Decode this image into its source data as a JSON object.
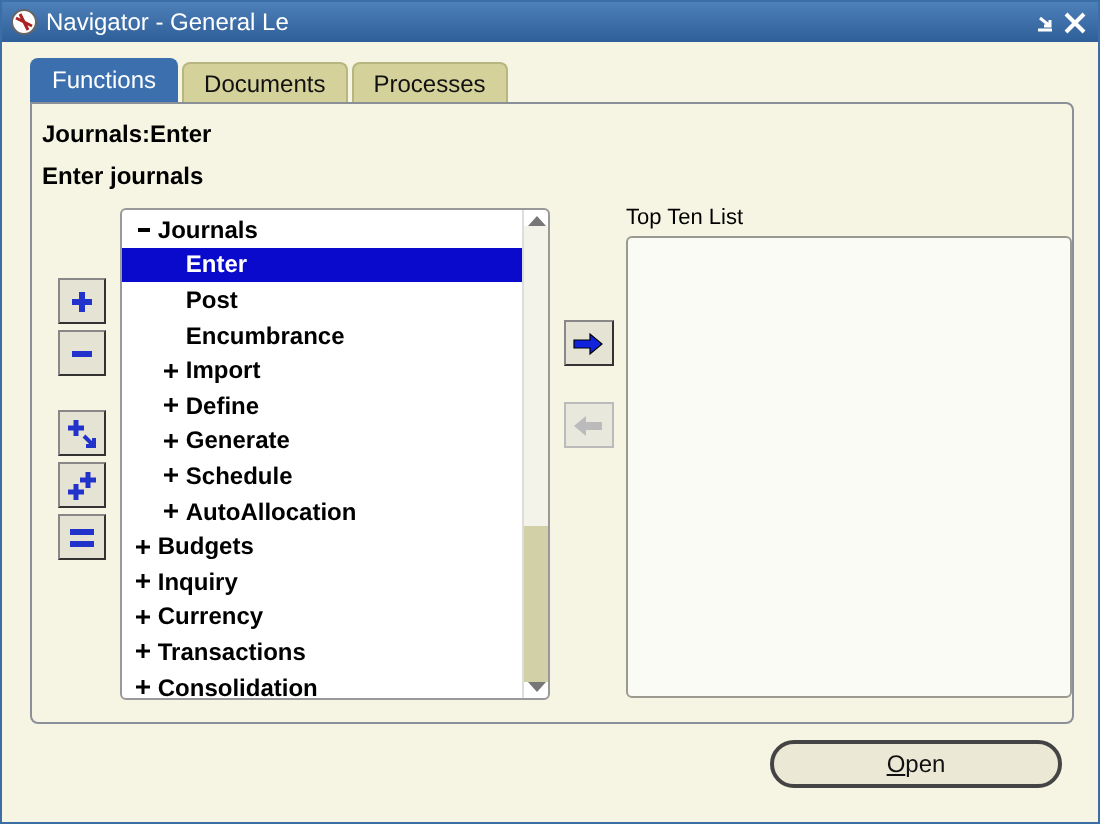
{
  "window": {
    "title": "Navigator - General Le"
  },
  "tabs": [
    {
      "label": "Functions",
      "selected": true
    },
    {
      "label": "Documents",
      "selected": false
    },
    {
      "label": "Processes",
      "selected": false
    }
  ],
  "function_path": "Journals:Enter",
  "function_description": "Enter journals",
  "tree": [
    {
      "label": "Journals",
      "kind": "node",
      "expanded": true,
      "selected": false,
      "children": [
        {
          "label": "Enter",
          "kind": "leaf",
          "selected": true
        },
        {
          "label": "Post",
          "kind": "leaf",
          "selected": false
        },
        {
          "label": "Encumbrance",
          "kind": "leaf",
          "selected": false
        },
        {
          "label": "Import",
          "kind": "node",
          "expanded": false,
          "selected": false
        },
        {
          "label": "Define",
          "kind": "node",
          "expanded": false,
          "selected": false
        },
        {
          "label": "Generate",
          "kind": "node",
          "expanded": false,
          "selected": false
        },
        {
          "label": "Schedule",
          "kind": "node",
          "expanded": false,
          "selected": false
        },
        {
          "label": "AutoAllocation",
          "kind": "node",
          "expanded": false,
          "selected": false
        }
      ]
    },
    {
      "label": "Budgets",
      "kind": "node",
      "expanded": false,
      "selected": false
    },
    {
      "label": "Inquiry",
      "kind": "node",
      "expanded": false,
      "selected": false
    },
    {
      "label": "Currency",
      "kind": "node",
      "expanded": false,
      "selected": false
    },
    {
      "label": "Transactions",
      "kind": "node",
      "expanded": false,
      "selected": false
    },
    {
      "label": "Consolidation",
      "kind": "node",
      "expanded": false,
      "selected": false
    }
  ],
  "tree_tools": [
    {
      "kind": "expand"
    },
    {
      "kind": "collapse"
    },
    {
      "kind": "expand-branch"
    },
    {
      "kind": "expand-all"
    },
    {
      "kind": "collapse-all"
    }
  ],
  "transfer_buttons": [
    {
      "kind": "add",
      "disabled": false
    },
    {
      "kind": "remove",
      "disabled": true
    }
  ],
  "top_ten": {
    "label": "Top Ten List"
  },
  "open_button": "Open"
}
